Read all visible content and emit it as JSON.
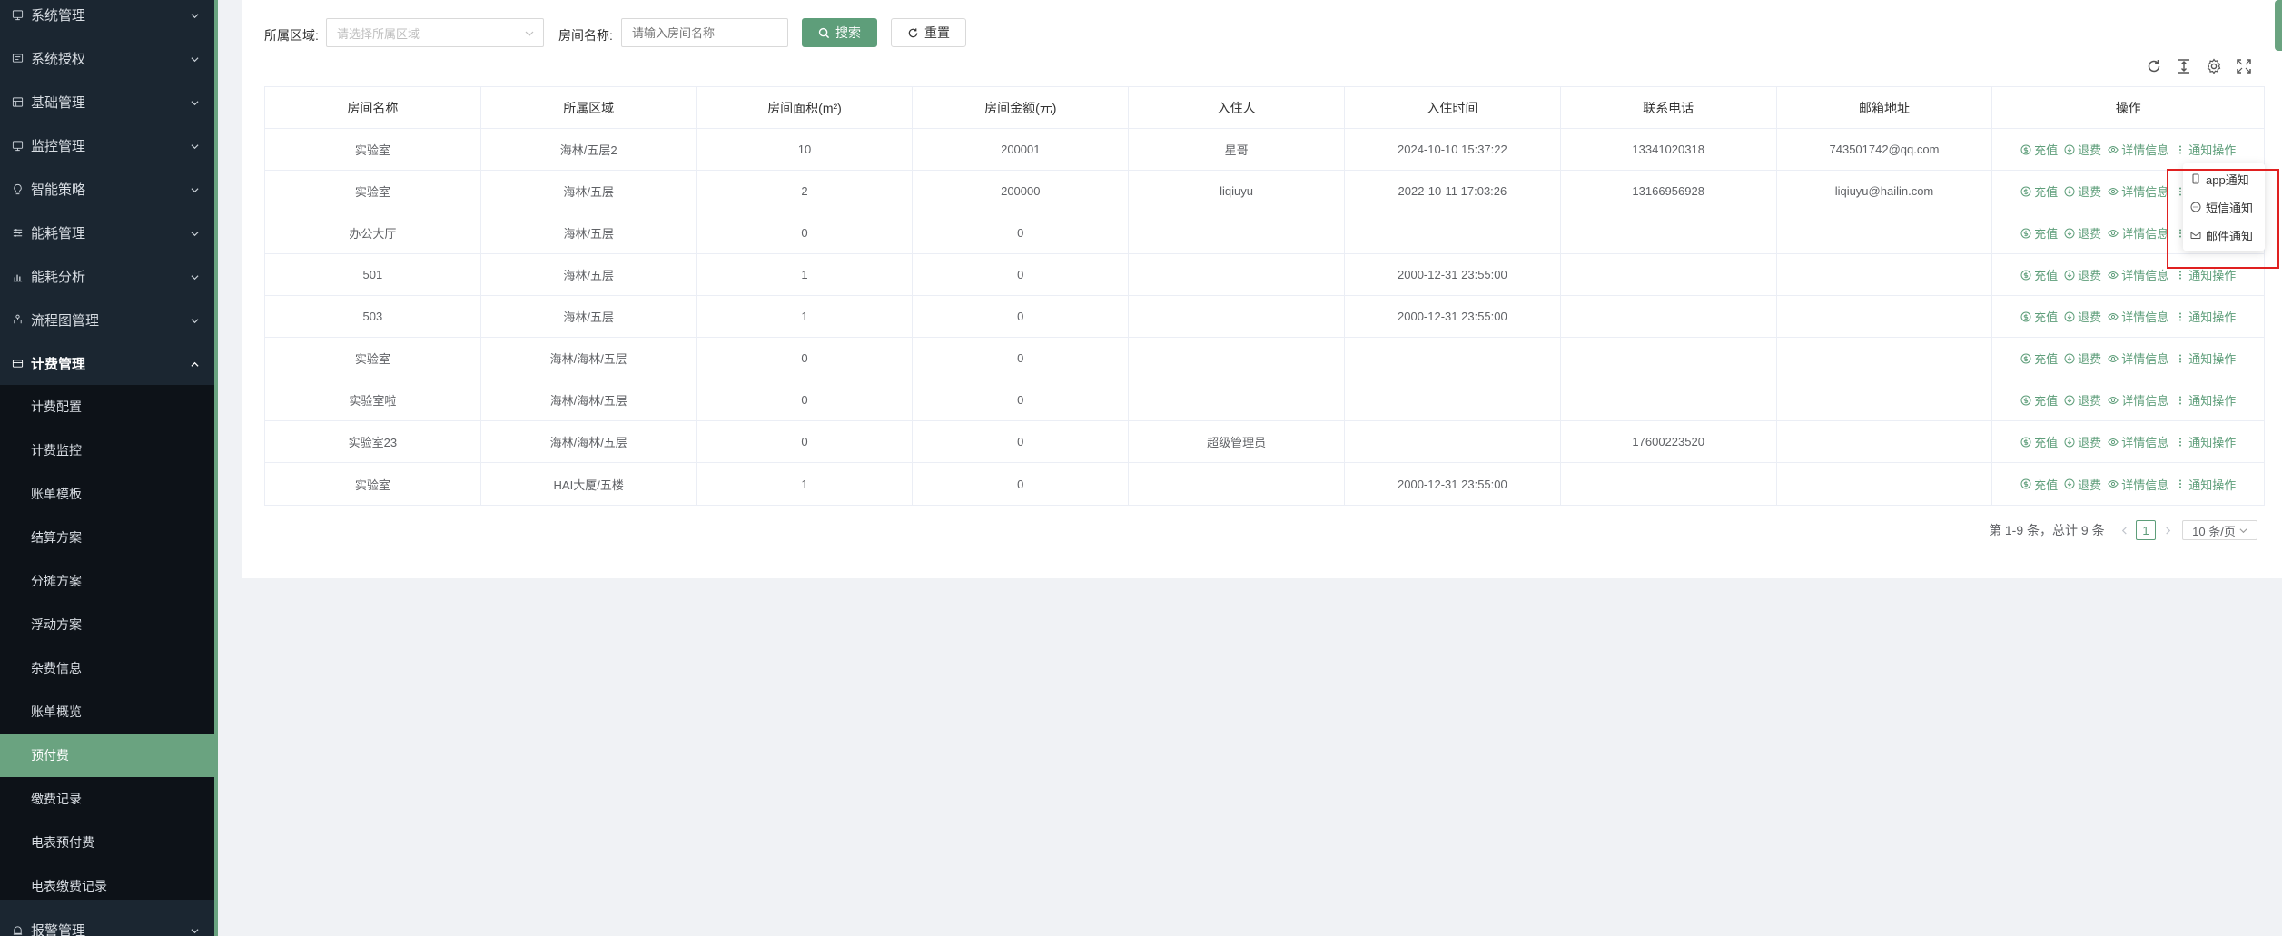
{
  "sidebar": {
    "menus": [
      {
        "label": "系统管理",
        "icon": "monitor-icon"
      },
      {
        "label": "系统授权",
        "icon": "key-icon"
      },
      {
        "label": "基础管理",
        "icon": "database-icon"
      },
      {
        "label": "监控管理",
        "icon": "monitor-icon"
      },
      {
        "label": "智能策略",
        "icon": "bulb-icon"
      },
      {
        "label": "能耗管理",
        "icon": "sliders-icon"
      },
      {
        "label": "能耗分析",
        "icon": "bar-chart-icon"
      },
      {
        "label": "流程图管理",
        "icon": "flow-icon"
      },
      {
        "label": "计费管理",
        "icon": "billing-icon"
      }
    ],
    "sub_items": [
      "计费配置",
      "计费监控",
      "账单模板",
      "结算方案",
      "分摊方案",
      "浮动方案",
      "杂费信息",
      "账单概览",
      "预付费",
      "缴费记录",
      "电表预付费",
      "电表缴费记录"
    ],
    "active_sub": "预付费",
    "bottom_menu": {
      "label": "报警管理",
      "icon": "alarm-icon"
    }
  },
  "filters": {
    "area_label": "所属区域:",
    "area_placeholder": "请选择所属区域",
    "room_label": "房间名称:",
    "room_placeholder": "请输入房间名称",
    "search_btn": "搜索",
    "reset_btn": "重置"
  },
  "table": {
    "headers": [
      "房间名称",
      "所属区域",
      "房间面积(m²)",
      "房间金额(元)",
      "入住人",
      "入住时间",
      "联系电话",
      "邮箱地址",
      "操作"
    ],
    "rows": [
      [
        "实验室",
        "海林/五层2",
        "10",
        "200001",
        "星哥",
        "2024-10-10 15:37:22",
        "13341020318",
        "743501742@qq.com"
      ],
      [
        "实验室",
        "海林/五层",
        "2",
        "200000",
        "liqiuyu",
        "2022-10-11 17:03:26",
        "13166956928",
        "liqiuyu@hailin.com"
      ],
      [
        "办公大厅",
        "海林/五层",
        "0",
        "0",
        "",
        "",
        "",
        ""
      ],
      [
        "501",
        "海林/五层",
        "1",
        "0",
        "",
        "2000-12-31 23:55:00",
        "",
        ""
      ],
      [
        "503",
        "海林/五层",
        "1",
        "0",
        "",
        "2000-12-31 23:55:00",
        "",
        ""
      ],
      [
        "实验室",
        "海林/海林/五层",
        "0",
        "0",
        "",
        "",
        "",
        ""
      ],
      [
        "实验室啦",
        "海林/海林/五层",
        "0",
        "0",
        "",
        "",
        "",
        ""
      ],
      [
        "实验室23",
        "海林/海林/五层",
        "0",
        "0",
        "超级管理员",
        "",
        "17600223520",
        ""
      ],
      [
        "实验室",
        "HAI大厦/五楼",
        "1",
        "0",
        "",
        "2000-12-31 23:55:00",
        "",
        ""
      ]
    ],
    "ops": {
      "recharge": "充值",
      "refund": "退费",
      "details": "详情信息",
      "notify": "通知操作"
    }
  },
  "dropdown": {
    "items": [
      {
        "label": "app通知",
        "icon": "mobile-icon"
      },
      {
        "label": "短信通知",
        "icon": "message-icon"
      },
      {
        "label": "邮件通知",
        "icon": "mail-icon"
      }
    ]
  },
  "pagination": {
    "summary": "第 1-9 条，总计 9 条",
    "current": "1",
    "page_size": "10 条/页"
  },
  "colors": {
    "accent": "#5e9e7a",
    "sidebar_bg": "#1b2631",
    "highlight": "#e02020"
  }
}
